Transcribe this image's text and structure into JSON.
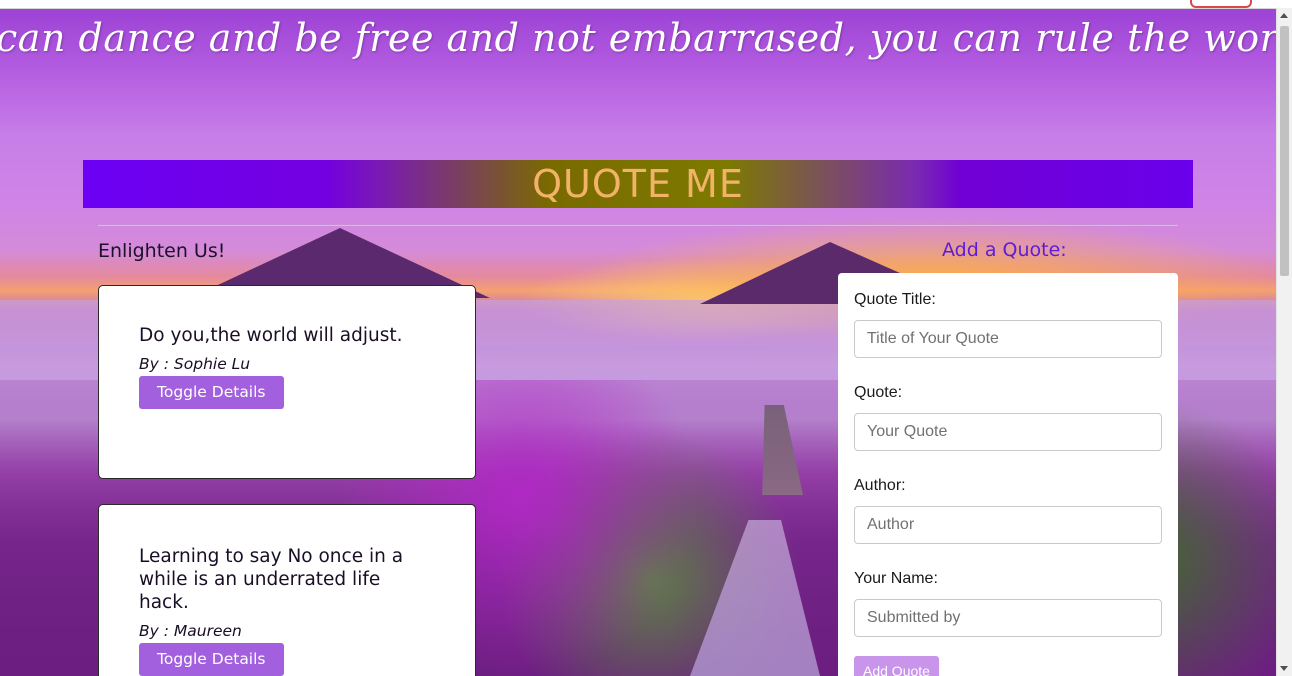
{
  "tagline": "can dance and be free and not embarrased, you can rule the world!",
  "banner": {
    "title": "QUOTE ME"
  },
  "quotes_section": {
    "title": "Enlighten Us!",
    "by_prefix": "By :",
    "items": [
      {
        "text": "Do you,the world will adjust.",
        "author": "Sophie Lu",
        "button": "Toggle Details"
      },
      {
        "text": "Learning to say No once in a while is an underrated life hack.",
        "author": "Maureen",
        "button": "Toggle Details"
      }
    ]
  },
  "form": {
    "title": "Add a Quote:",
    "fields": [
      {
        "label": "Quote Title:",
        "placeholder": "Title of Your Quote"
      },
      {
        "label": "Quote:",
        "placeholder": "Your Quote"
      },
      {
        "label": "Author:",
        "placeholder": "Author"
      },
      {
        "label": "Your Name:",
        "placeholder": "Submitted by"
      }
    ],
    "submit_label": "Add Quote"
  },
  "colors": {
    "banner_text": "#f2b368",
    "button": "#a25fde",
    "submit_button": "#c895ea",
    "form_title": "#5d1cd6"
  }
}
